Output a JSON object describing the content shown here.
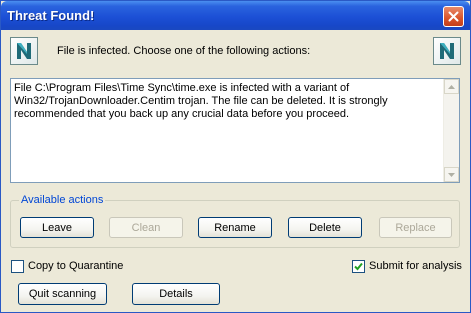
{
  "window": {
    "title": "Threat Found!"
  },
  "header": {
    "message": "File is infected. Choose one of the following actions:",
    "logo_icon": "norman-n-logo"
  },
  "details": {
    "text": "File C:\\Program Files\\Time Sync\\time.exe is infected with a variant of Win32/TrojanDownloader.Centim trojan. The file can be deleted. It is strongly recommended that you back up any crucial data before you proceed."
  },
  "actions": {
    "group_label": "Available actions",
    "leave": "Leave",
    "clean": "Clean",
    "rename": "Rename",
    "delete": "Delete",
    "replace": "Replace"
  },
  "options": {
    "quarantine_label": "Copy to Quarantine",
    "quarantine_checked": false,
    "submit_label": "Submit for analysis",
    "submit_checked": true
  },
  "footer": {
    "quit_label": "Quit scanning",
    "details_label": "Details"
  },
  "colors": {
    "titlebar": "#1c50d6",
    "group_label": "#0046d5",
    "window_bg": "#ece9d8",
    "close_button": "#d9542b"
  }
}
